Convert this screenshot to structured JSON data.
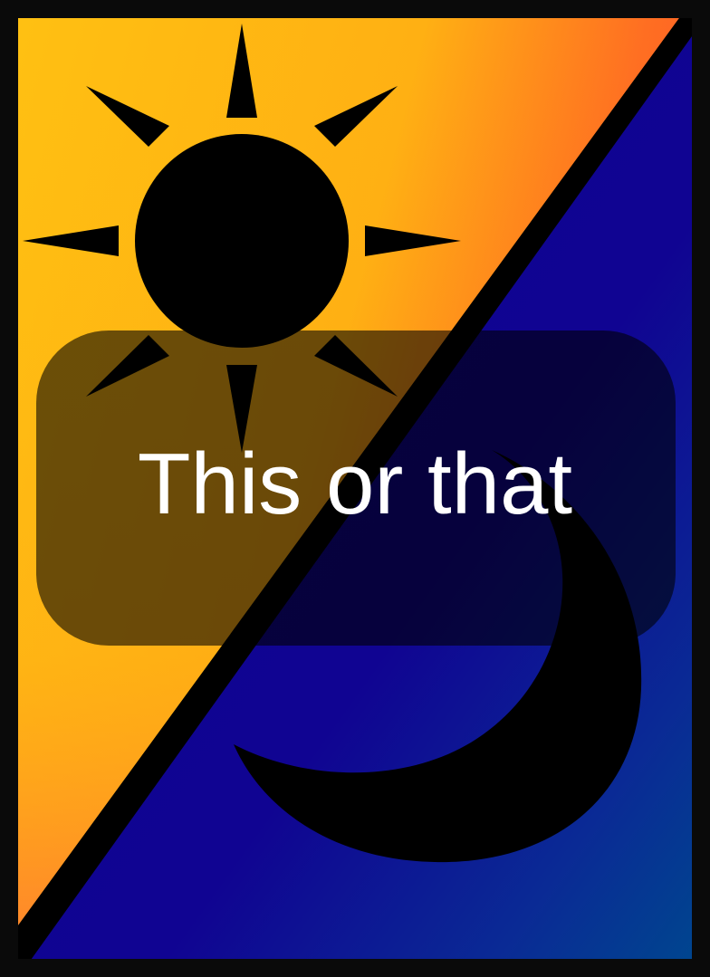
{
  "card": {
    "title": "This or that",
    "sun_icon": "sun-icon",
    "moon_icon": "moon-icon"
  },
  "colors": {
    "frame": "#0a0a0a",
    "sun_side_light": "#ffc012",
    "sun_side_dark": "#ff5a26",
    "moon_side_light": "#0c0694",
    "moon_side_dark": "#00458f",
    "title_text": "#ffffff",
    "title_panel": "#000000"
  }
}
